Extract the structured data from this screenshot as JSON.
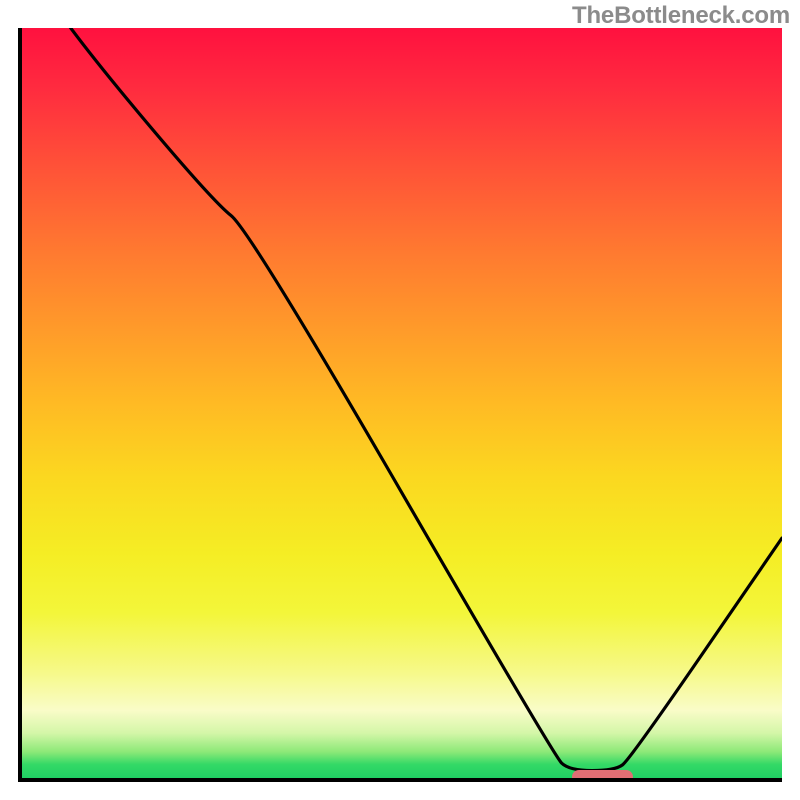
{
  "watermark": "TheBottleneck.com",
  "chart_data": {
    "type": "line",
    "title": "",
    "xlabel": "",
    "ylabel": "",
    "xlim": [
      0,
      100
    ],
    "ylim": [
      0,
      100
    ],
    "x": [
      0,
      6,
      25,
      30,
      70,
      72,
      78,
      80,
      100
    ],
    "values": [
      110,
      100,
      77,
      73,
      3,
      1,
      1,
      2.5,
      32
    ],
    "marker": {
      "x_start": 72,
      "x_end": 80,
      "y": 0.7
    },
    "gradient_stops": [
      {
        "pos": 0,
        "color": "#ff113f"
      },
      {
        "pos": 50,
        "color": "#ffba24"
      },
      {
        "pos": 78,
        "color": "#f3f63a"
      },
      {
        "pos": 96.5,
        "color": "#8de978"
      },
      {
        "pos": 100,
        "color": "#20cf63"
      }
    ]
  }
}
